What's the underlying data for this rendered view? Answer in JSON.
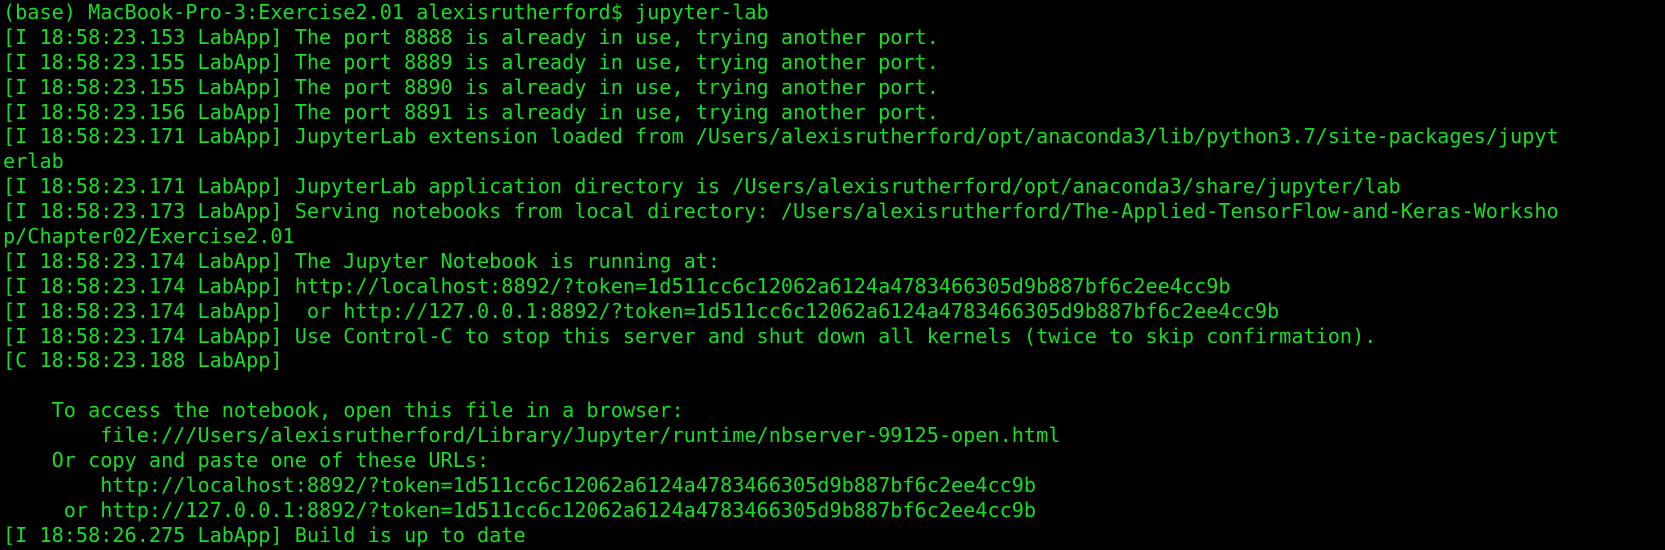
{
  "terminal": {
    "text_color": "#18dc27",
    "background_color": "#000000",
    "lines": [
      "(base) MacBook-Pro-3:Exercise2.01 alexisrutherford$ jupyter-lab",
      "[I 18:58:23.153 LabApp] The port 8888 is already in use, trying another port.",
      "[I 18:58:23.155 LabApp] The port 8889 is already in use, trying another port.",
      "[I 18:58:23.155 LabApp] The port 8890 is already in use, trying another port.",
      "[I 18:58:23.156 LabApp] The port 8891 is already in use, trying another port.",
      "[I 18:58:23.171 LabApp] JupyterLab extension loaded from /Users/alexisrutherford/opt/anaconda3/lib/python3.7/site-packages/jupyt",
      "erlab",
      "[I 18:58:23.171 LabApp] JupyterLab application directory is /Users/alexisrutherford/opt/anaconda3/share/jupyter/lab",
      "[I 18:58:23.173 LabApp] Serving notebooks from local directory: /Users/alexisrutherford/The-Applied-TensorFlow-and-Keras-Worksho",
      "p/Chapter02/Exercise2.01",
      "[I 18:58:23.174 LabApp] The Jupyter Notebook is running at:",
      "[I 18:58:23.174 LabApp] http://localhost:8892/?token=1d511cc6c12062a6124a4783466305d9b887bf6c2ee4cc9b",
      "[I 18:58:23.174 LabApp]  or http://127.0.0.1:8892/?token=1d511cc6c12062a6124a4783466305d9b887bf6c2ee4cc9b",
      "[I 18:58:23.174 LabApp] Use Control-C to stop this server and shut down all kernels (twice to skip confirmation).",
      "[C 18:58:23.188 LabApp]",
      "",
      "    To access the notebook, open this file in a browser:",
      "        file:///Users/alexisrutherford/Library/Jupyter/runtime/nbserver-99125-open.html",
      "    Or copy and paste one of these URLs:",
      "        http://localhost:8892/?token=1d511cc6c12062a6124a4783466305d9b887bf6c2ee4cc9b",
      "     or http://127.0.0.1:8892/?token=1d511cc6c12062a6124a4783466305d9b887bf6c2ee4cc9b",
      "[I 18:58:26.275 LabApp] Build is up to date"
    ]
  }
}
